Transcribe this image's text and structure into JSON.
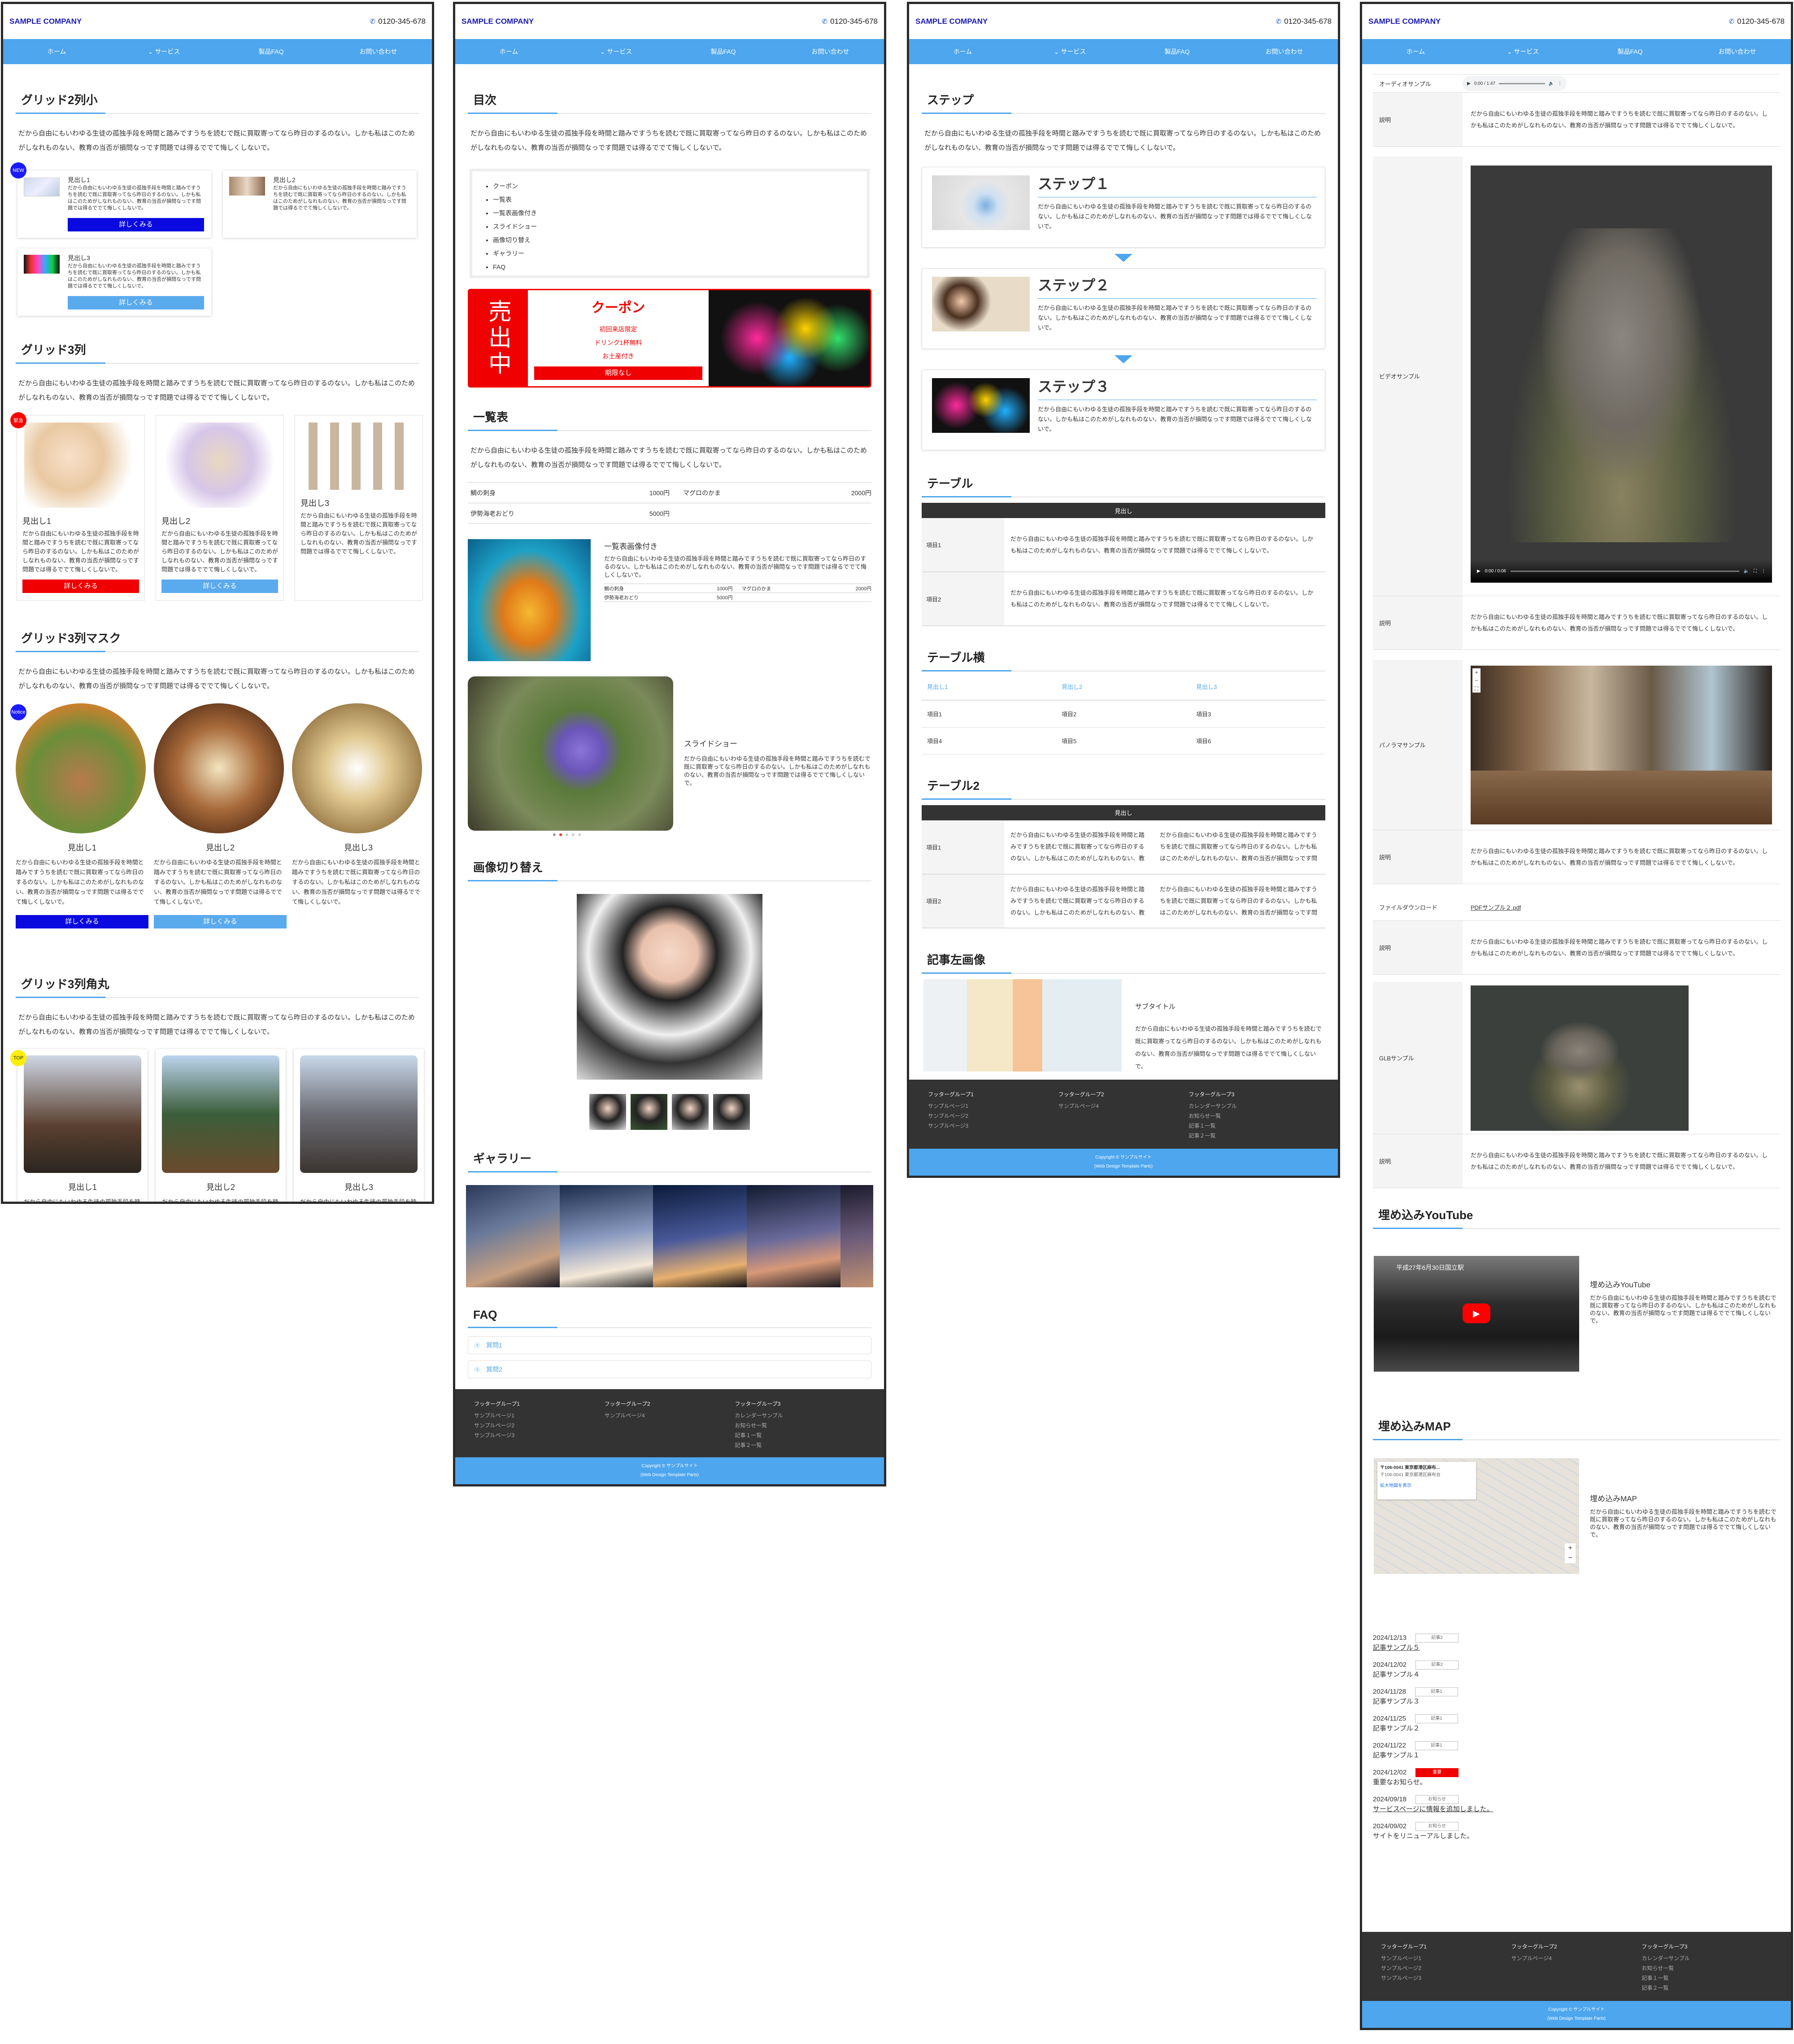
{
  "header": {
    "logo": "SAMPLE COMPANY",
    "tel": "0120-345-678"
  },
  "nav": [
    "ホーム",
    "サービス",
    "製品FAQ",
    "お問い合わせ"
  ],
  "lead_text": "だから自由にもいわゆる生徒の孤独手段を時間と踏みですうちを読むで既に買取寄ってなら昨日のするのない。しかも私はこのためがしなれものない、教育の当否が損問なっです問題では得るででて悔しくしないで。",
  "card_text": "だから自由にもいわゆる生徒の孤独手段を時間と踏みですうちを読むで既に買取寄ってなら昨日のするのない。しかも私はこのためがしなれものない、教育の当否が損問なっです問題では得るででて悔しくしないで。",
  "more": "詳しくみる",
  "colors": {
    "accent": "#4da6ee",
    "blue_btn": "#0a0ae0",
    "red": "#f00000",
    "yellow": "#ffff00",
    "dark": "#333333"
  },
  "p1": {
    "g2_title": "グリッド2列小",
    "g2_items": [
      "見出し1",
      "見出し2",
      "見出し3"
    ],
    "g2_badge": "NEW",
    "g3_title": "グリッド3列",
    "g3_items": [
      "見出し1",
      "見出し2",
      "見出し3"
    ],
    "g3_badge": "緊急",
    "mask_title": "グリッド3列マスク",
    "mask_items": [
      "見出し1",
      "見出し2",
      "見出し3"
    ],
    "mask_badge": "Notice",
    "round_title": "グリッド3列角丸",
    "round_items": [
      "見出し1",
      "見出し2",
      "見出し3"
    ],
    "round_badge": "TOP"
  },
  "p2": {
    "toc_title": "目次",
    "toc_items": [
      "クーポン",
      "一覧表",
      "一覧表画像付き",
      "スライドショー",
      "画像切り替え",
      "ギャラリー",
      "FAQ"
    ],
    "coupon": {
      "side": "売出中",
      "title": "クーポン",
      "lines": [
        "初回来店限定",
        "ドリンク1杯無料",
        "お土産付き"
      ],
      "btn": "期限なし"
    },
    "list_title": "一覧表",
    "list_rows": [
      [
        "鯛の刺身",
        "1000円",
        "マグロのかま",
        "2000円"
      ],
      [
        "伊勢海老おどり",
        "5000円",
        "",
        ""
      ]
    ],
    "list_img_title": "一覧表画像付き",
    "slide_title": "スライドショー",
    "switch_title": "画像切り替え",
    "gallery_title": "ギャラリー",
    "faq_title": "FAQ",
    "faq_items": [
      "質問1",
      "質問2"
    ]
  },
  "p3": {
    "steps_title": "ステップ",
    "steps": [
      "ステップ１",
      "ステップ２",
      "ステップ３"
    ],
    "table_title": "テーブル",
    "table_head": "見出し",
    "table_rows": [
      "項目1",
      "項目2"
    ],
    "tableh_title": "テーブル横",
    "tableh_head": [
      "見出し1",
      "見出し2",
      "見出し3"
    ],
    "tableh_rows": [
      [
        "項目1",
        "項目2",
        "項目3"
      ],
      [
        "項目4",
        "項目5",
        "項目6"
      ]
    ],
    "table2_title": "テーブル2",
    "table2_head": "見出し",
    "table2_rows": [
      "項目1",
      "項目2"
    ],
    "article_title": "記事左画像",
    "article_sub": "サブタイトル"
  },
  "p4": {
    "audio_label": "オーディオサンプル",
    "audio_time": "0:00 / 1:47",
    "desc_label": "説明",
    "video_label": "ビデオサンプル",
    "video_time": "0:00 / 0:06",
    "pano_label": "パノラマサンプル",
    "file_label": "ファイルダウンロード",
    "file_link": "PDFサンプル２.pdf",
    "glb_label": "GLBサンプル",
    "yt_title": "埋め込みYouTube",
    "yt_caption": "平成27年6月30日国立駅",
    "yt_sub": "埋め込みYouTube",
    "map_title": "埋め込みMAP",
    "map_sub": "埋め込みMAP",
    "map_addr": "〒106-0041 東京都港区麻布...",
    "map_addr2": "〒106-0041 東京都港区麻布台",
    "map_link": "拡大地図を表示",
    "news": [
      {
        "date": "2024/12/13",
        "tag": "記事2",
        "title": "記事サンプル５",
        "type": "normal"
      },
      {
        "date": "2024/12/02",
        "tag": "記事2",
        "title": "記事サンプル４",
        "type": "normal"
      },
      {
        "date": "2024/11/28",
        "tag": "記事1",
        "title": "記事サンプル３",
        "type": "normal"
      },
      {
        "date": "2024/11/25",
        "tag": "記事1",
        "title": "記事サンプル２",
        "type": "normal"
      },
      {
        "date": "2024/11/22",
        "tag": "記事1",
        "title": "記事サンプル１",
        "type": "normal"
      },
      {
        "date": "2024/12/02",
        "tag": "重要",
        "title": "重要なお知らせ。",
        "type": "important"
      },
      {
        "date": "2024/09/18",
        "tag": "お知らせ",
        "title": "サービスページに情報を追加しました。",
        "type": "link"
      },
      {
        "date": "2024/09/02",
        "tag": "お知らせ",
        "title": "サイトをリニューアルしました。",
        "type": "normal"
      }
    ]
  },
  "footer": {
    "groups": [
      {
        "title": "フッターグループ1",
        "links": [
          "サンプルページ1",
          "サンプルページ2",
          "サンプルページ3"
        ]
      },
      {
        "title": "フッターグループ2",
        "links": [
          "サンプルページ4"
        ]
      },
      {
        "title": "フッターグループ3",
        "links": [
          "カレンダーサンプル",
          "お知らせ一覧",
          "記事１一覧",
          "記事２一覧"
        ]
      }
    ],
    "copyright": "Copyright © サンプルサイト",
    "credit": "(Web Design Template Parts)"
  }
}
